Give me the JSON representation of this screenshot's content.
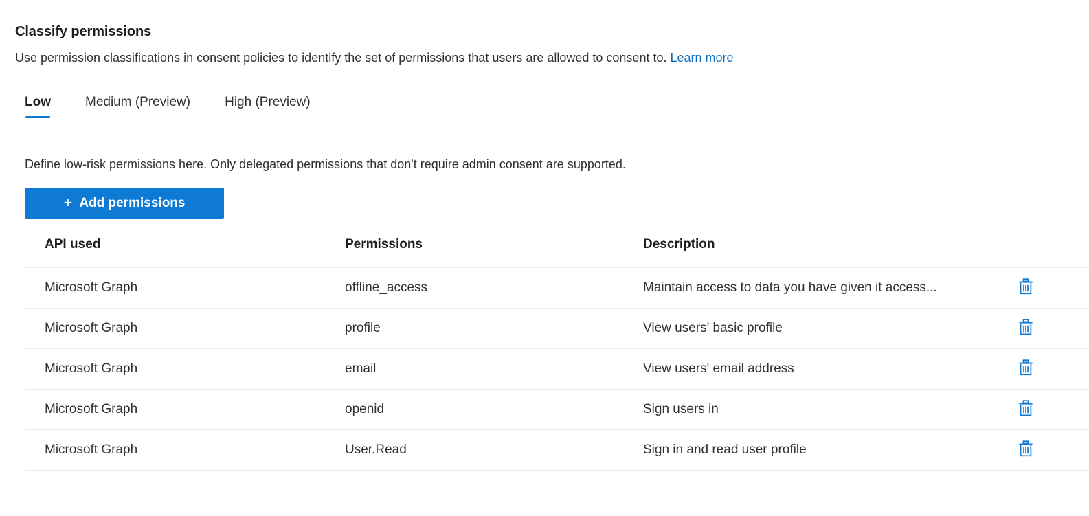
{
  "page": {
    "title": "Classify permissions",
    "description_text": "Use permission classifications in consent policies to identify the set of permissions that users are allowed to consent to. ",
    "learn_more_label": "Learn more",
    "section_note": "Define low-risk permissions here. Only delegated permissions that don't require admin consent are supported."
  },
  "tabs": [
    {
      "label": "Low",
      "active": true
    },
    {
      "label": "Medium (Preview)",
      "active": false
    },
    {
      "label": "High (Preview)",
      "active": false
    }
  ],
  "toolbar": {
    "add_permissions_label": "Add permissions",
    "add_permissions_icon": "plus-icon",
    "add_button_color": "#0f7ad4"
  },
  "table": {
    "headers": {
      "api_used": "API used",
      "permissions": "Permissions",
      "description": "Description"
    },
    "rows": [
      {
        "api": "Microsoft Graph",
        "permission": "offline_access",
        "description": "Maintain access to data you have given it access...",
        "delete_icon": "trash-icon"
      },
      {
        "api": "Microsoft Graph",
        "permission": "profile",
        "description": "View users' basic profile",
        "delete_icon": "trash-icon"
      },
      {
        "api": "Microsoft Graph",
        "permission": "email",
        "description": "View users' email address",
        "delete_icon": "trash-icon"
      },
      {
        "api": "Microsoft Graph",
        "permission": "openid",
        "description": "Sign users in",
        "delete_icon": "trash-icon"
      },
      {
        "api": "Microsoft Graph",
        "permission": "User.Read",
        "description": "Sign in and read user profile",
        "delete_icon": "trash-icon"
      }
    ]
  },
  "colors": {
    "accent_blue": "#0f7ad4",
    "link_blue": "#0f6cbd",
    "text_primary": "#201f1e",
    "text_secondary": "#323130",
    "row_border": "#edebe9"
  }
}
